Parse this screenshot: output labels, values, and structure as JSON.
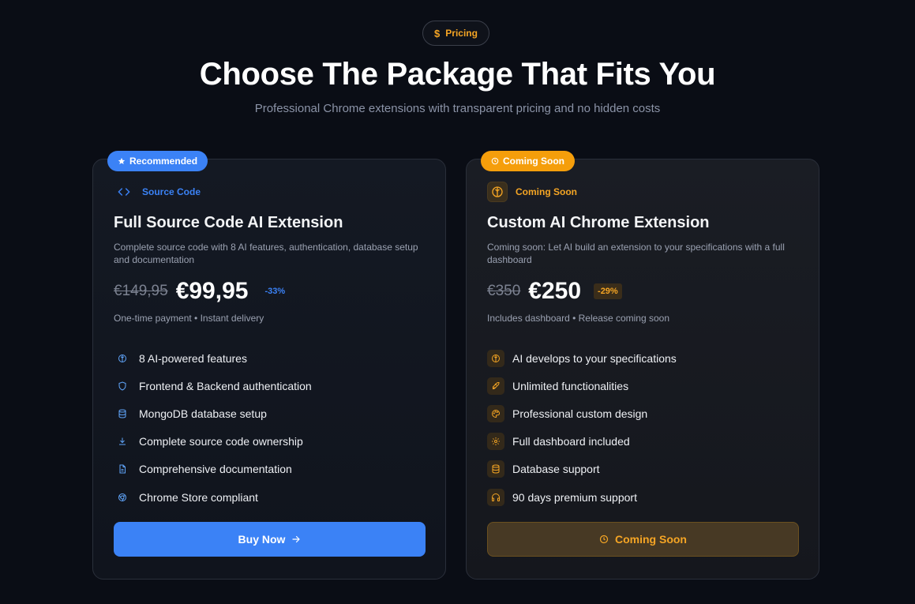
{
  "header": {
    "pill_icon": "$",
    "pill_label": "Pricing",
    "title": "Choose The Package That Fits You",
    "subtitle": "Professional Chrome extensions with transparent pricing and no hidden costs"
  },
  "colors": {
    "blue": "#3b82f6",
    "amber": "#f5a524",
    "background": "#0a0d15"
  },
  "cards": [
    {
      "badge": "Recommended",
      "badge_icon": "star-icon",
      "tag": "Source Code",
      "tag_icon": "code-icon",
      "title": "Full Source Code AI Extension",
      "description": "Complete source code with 8 AI features, authentication, database setup and documentation",
      "old_price": "€149,95",
      "price": "€99,95",
      "discount": "-33%",
      "note": "One-time payment • Instant delivery",
      "features": [
        {
          "icon": "brain-icon",
          "label": "8 AI-powered features"
        },
        {
          "icon": "shield-icon",
          "label": "Frontend & Backend authentication"
        },
        {
          "icon": "database-icon",
          "label": "MongoDB database setup"
        },
        {
          "icon": "download-icon",
          "label": "Complete source code ownership"
        },
        {
          "icon": "document-icon",
          "label": "Comprehensive documentation"
        },
        {
          "icon": "chrome-icon",
          "label": "Chrome Store compliant"
        }
      ],
      "cta": "Buy Now",
      "cta_icon": "arrow-right-icon"
    },
    {
      "badge": "Coming Soon",
      "badge_icon": "clock-icon",
      "tag": "Coming Soon",
      "tag_icon": "brain-icon",
      "title": "Custom AI Chrome Extension",
      "description": "Coming soon: Let AI build an extension to your specifications with a full dashboard",
      "old_price": "€350",
      "price": "€250",
      "discount": "-29%",
      "note": "Includes dashboard • Release coming soon",
      "features": [
        {
          "icon": "brain-icon",
          "label": "AI develops to your specifications"
        },
        {
          "icon": "rocket-icon",
          "label": "Unlimited functionalities"
        },
        {
          "icon": "palette-icon",
          "label": "Professional custom design"
        },
        {
          "icon": "gear-icon",
          "label": "Full dashboard included"
        },
        {
          "icon": "database-icon",
          "label": "Database support"
        },
        {
          "icon": "headphones-icon",
          "label": "90 days premium support"
        }
      ],
      "cta": "Coming Soon",
      "cta_icon": "clock-icon"
    }
  ]
}
